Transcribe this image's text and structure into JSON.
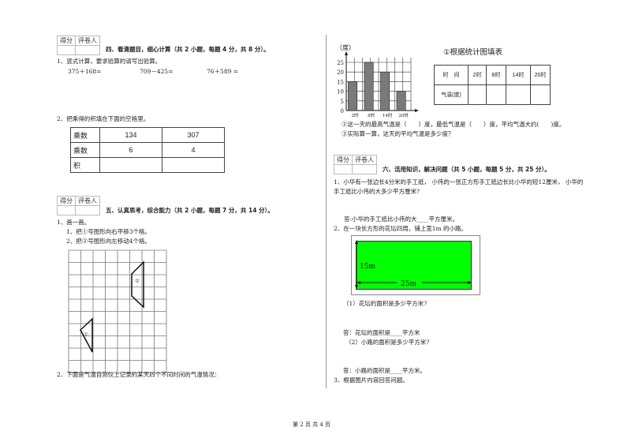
{
  "score_box": {
    "score_label": "得分",
    "grader_label": "评卷人"
  },
  "section4": {
    "title": "四、看清题目，细心计算（共 2 小题，每题 4 分，共 8 分）。",
    "q1": {
      "prompt": "1、竖式计算，要求验算的请写出验算。",
      "items": [
        "375＋168=",
        "709－425=",
        "76＋589 ="
      ]
    },
    "q2": {
      "prompt": "2、把乘得的积填在下面的空格里。",
      "table": {
        "rows": [
          {
            "label": "乘数",
            "values": [
              "134",
              "307"
            ]
          },
          {
            "label": "乘数",
            "values": [
              "6",
              "4"
            ]
          },
          {
            "label": "积",
            "values": [
              "",
              ""
            ]
          }
        ]
      }
    }
  },
  "section5": {
    "title": "五、认真思考，综合能力（共 2 小题，每题 7 分，共 14 分）。",
    "q1": {
      "prompt": "1、画一画。",
      "sub": [
        "1、把①号图形向右平移3个格。",
        "2、把②号图形向左移动4个格。"
      ],
      "grid": {
        "columns": 8,
        "rows": 10
      },
      "shapes": [
        {
          "label": "①",
          "type": "triangle"
        },
        {
          "label": "②",
          "type": "trapezoid"
        }
      ]
    },
    "q2": {
      "prompt": "2、下面是气温自测仪上记录的某天四个不同时间的气温情况："
    }
  },
  "temp_question": {
    "table_title": "①根据统计图填表",
    "table_headers": [
      "时　间",
      "2时",
      "8时",
      "14时",
      "20时"
    ],
    "table_row_label": "气温(度)",
    "q2": "②这一天的最高气温是（　　）度，最低气温是（　　）度，平均气温大约(　　)度。",
    "q3": "③实际算一算，这天的平均气温是多少度？"
  },
  "chart_data": {
    "type": "bar",
    "title": "",
    "ylabel": "（度）",
    "xlabel": "",
    "categories": [
      "2时",
      "8时",
      "14时",
      "20时"
    ],
    "values": [
      15,
      25,
      20,
      10
    ],
    "ylim": [
      0,
      25
    ],
    "yticks": [
      0,
      5,
      10,
      15,
      20,
      25
    ],
    "grid": true,
    "bar_color": "#7a7a7a"
  },
  "section6": {
    "title": "六、活用知识，解决问题（共 5 小题，每题 5 分，共 25 分）。",
    "q1": {
      "line1": "1、小华有一张边长4分米的手工纸，  小伟的一张正方形手工纸边长比小华的短12厘米，  小华的",
      "line2": "手工纸比小伟的大多少平方厘米?",
      "answer": "答:小华的手工纸比小伟的大____平方厘米。"
    },
    "q2": {
      "prompt": "2、在一块长方形的花坛四周，铺上宽1m 的小路。",
      "figure": {
        "height_label": "15m",
        "width_label": "25m",
        "fill_color": "#00ff00"
      },
      "sub1": "（1）花坛的面积是多少平方米?",
      "ans1": "答：花坛的面积是____平方米",
      "sub2": "（2）小路的面积是多少平方米?",
      "ans2": "答：小路的面积是____平方米。"
    },
    "q3": {
      "prompt": "3、根据图片内容回答问题。"
    }
  },
  "footer": {
    "page": "第 2 页 共 4 页"
  }
}
